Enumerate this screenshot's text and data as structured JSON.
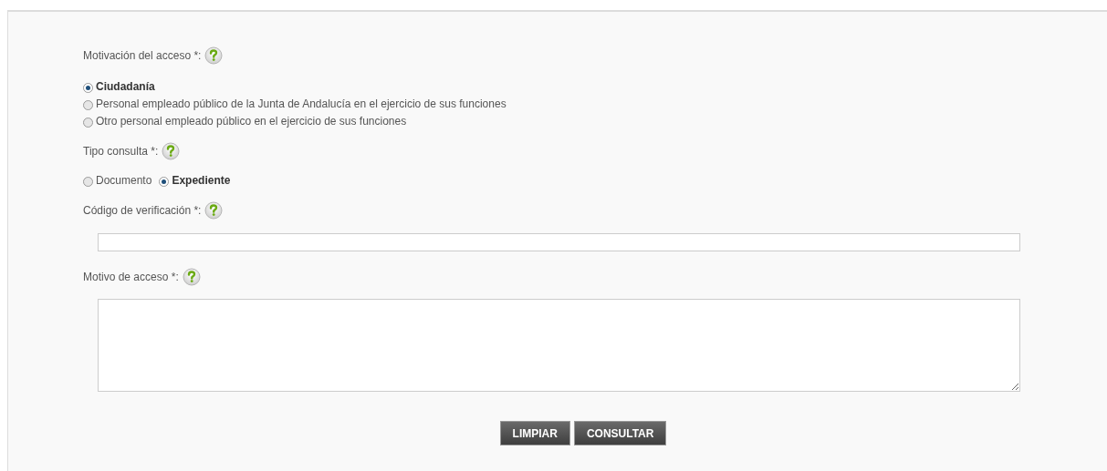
{
  "motivacion": {
    "label": "Motivación del acceso *:",
    "options": [
      {
        "label": "Ciudadanía",
        "selected": true
      },
      {
        "label": "Personal empleado público de la Junta de Andalucía en el ejercicio de sus funciones",
        "selected": false
      },
      {
        "label": "Otro personal empleado público en el ejercicio de sus funciones",
        "selected": false
      }
    ]
  },
  "tipo_consulta": {
    "label": "Tipo consulta *:",
    "options": [
      {
        "label": "Documento",
        "selected": false
      },
      {
        "label": "Expediente",
        "selected": true
      }
    ]
  },
  "codigo": {
    "label": "Código de verificación *:"
  },
  "motivo": {
    "label": "Motivo de acceso *:"
  },
  "buttons": [
    "LIMPIAR",
    "CONSULTAR"
  ]
}
